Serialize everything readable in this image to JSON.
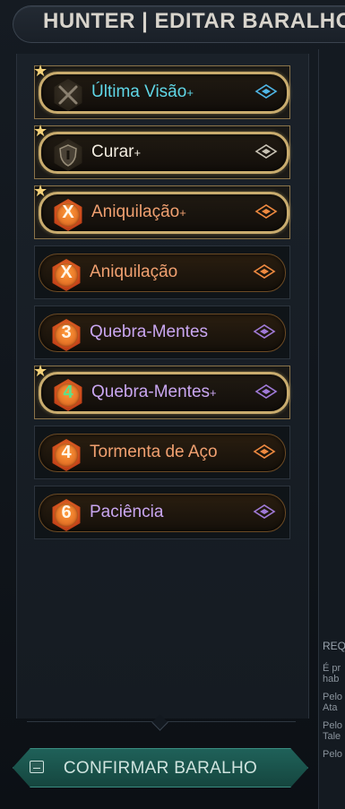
{
  "header": {
    "title": "HUNTER | EDITAR BARALHO"
  },
  "deck": {
    "cards": [
      {
        "name": "Última Visão",
        "upgraded": true,
        "starred": true,
        "selected": true,
        "cost": "",
        "icon": "crossed-swords-icon",
        "name_color": "#5fd6e6",
        "rarity_color": "#4fb6e6"
      },
      {
        "name": "Curar",
        "upgraded": true,
        "starred": true,
        "selected": true,
        "cost": "",
        "icon": "shield-icon",
        "name_color": "#f2ece0",
        "rarity_color": "#c8c2b4"
      },
      {
        "name": "Aniquilação",
        "upgraded": true,
        "starred": true,
        "selected": true,
        "cost": "X",
        "icon": "cost-badge-icon",
        "name_color": "#f0a070",
        "rarity_color": "#f08a40"
      },
      {
        "name": "Aniquilação",
        "upgraded": false,
        "starred": false,
        "selected": false,
        "cost": "X",
        "icon": "cost-badge-icon",
        "name_color": "#f0a070",
        "rarity_color": "#f08a40"
      },
      {
        "name": "Quebra-Mentes",
        "upgraded": false,
        "starred": false,
        "selected": false,
        "cost": "3",
        "icon": "cost-badge-icon",
        "name_color": "#c9a6f0",
        "rarity_color": "#a07ad8"
      },
      {
        "name": "Quebra-Mentes",
        "upgraded": true,
        "starred": true,
        "selected": true,
        "cost": "4",
        "cost_green": true,
        "icon": "cost-badge-icon",
        "name_color": "#c9a6f0",
        "rarity_color": "#a07ad8"
      },
      {
        "name": "Tormenta de Aço",
        "upgraded": false,
        "starred": false,
        "selected": false,
        "cost": "4",
        "icon": "cost-badge-icon",
        "name_color": "#f0a070",
        "rarity_color": "#f08a40"
      },
      {
        "name": "Paciência",
        "upgraded": false,
        "starred": false,
        "selected": false,
        "cost": "6",
        "icon": "cost-badge-icon",
        "name_color": "#c9a6f0",
        "rarity_color": "#a07ad8"
      }
    ],
    "plus_sign": "+"
  },
  "side_panel": {
    "title": "REQ",
    "lines": [
      "É pr",
      "hab",
      "Pelo",
      "Ata",
      "Pelo",
      "Tale",
      "Pelo"
    ]
  },
  "confirm_button": {
    "label": "CONFIRMAR BARALHO",
    "icon": "keyboard-key-icon"
  },
  "colors": {
    "accent_teal": "#1f6159",
    "gold_border": "#c9ac6e"
  }
}
